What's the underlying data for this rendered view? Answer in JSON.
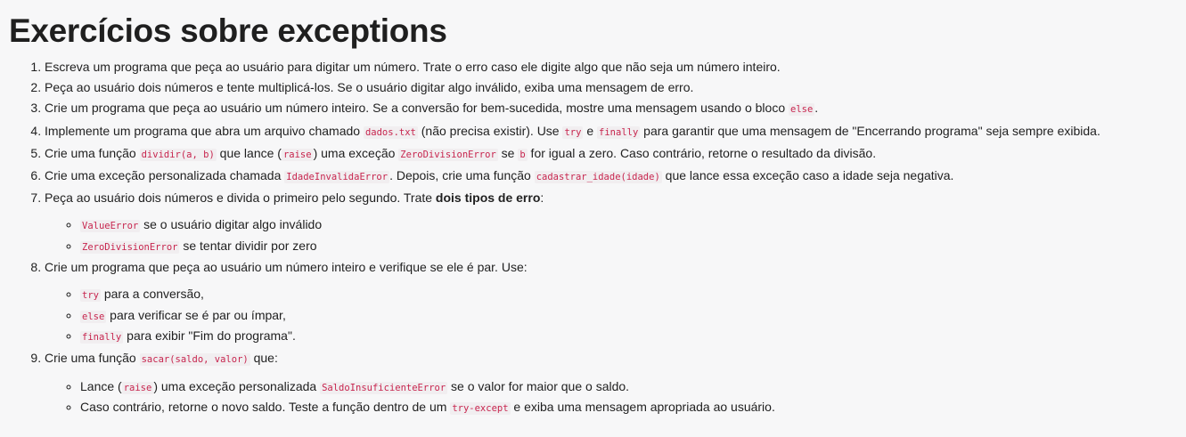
{
  "title": "Exercícios sobre exceptions",
  "items": [
    {
      "num": "1.",
      "parts": [
        "Escreva um programa que peça ao usuário para digitar um número. Trate o erro caso ele digite algo que não seja um número inteiro."
      ]
    },
    {
      "num": "2.",
      "parts": [
        "Peça ao usuário dois números e tente multiplicá-los. Se o usuário digitar algo inválido, exiba uma mensagem de erro."
      ]
    },
    {
      "num": "3.",
      "parts": [
        "Crie um programa que peça ao usuário um número inteiro. Se a conversão for bem-sucedida, mostre uma mensagem usando o bloco ",
        "else",
        "."
      ]
    },
    {
      "num": "4.",
      "parts": [
        "Implemente um programa que abra um arquivo chamado ",
        "dados.txt",
        " (não precisa existir). Use ",
        "try",
        " e ",
        "finally",
        " para garantir que uma mensagem de \"Encerrando programa\" seja sempre exibida."
      ]
    },
    {
      "num": "5.",
      "parts": [
        "Crie uma função ",
        "dividir(a, b)",
        " que lance (",
        "raise",
        ") uma exceção ",
        "ZeroDivisionError",
        " se ",
        "b",
        " for igual a zero. Caso contrário, retorne o resultado da divisão."
      ]
    },
    {
      "num": "6.",
      "parts": [
        "Crie uma exceção personalizada chamada ",
        "IdadeInvalidaError",
        ". Depois, crie uma função ",
        "cadastrar_idade(idade)",
        " que lance essa exceção caso a idade seja negativa."
      ]
    },
    {
      "num": "7.",
      "parts": [
        "Peça ao usuário dois números e divida o primeiro pelo segundo. Trate ",
        "dois tipos de erro",
        ":"
      ],
      "sub": [
        {
          "parts": [
            "ValueError",
            " se o usuário digitar algo inválido"
          ]
        },
        {
          "parts": [
            "ZeroDivisionError",
            " se tentar dividir por zero"
          ]
        }
      ]
    },
    {
      "num": "8.",
      "parts": [
        "Crie um programa que peça ao usuário um número inteiro e verifique se ele é par. Use:"
      ],
      "sub": [
        {
          "parts": [
            "try",
            " para a conversão,"
          ]
        },
        {
          "parts": [
            "else",
            " para verificar se é par ou ímpar,"
          ]
        },
        {
          "parts": [
            "finally",
            " para exibir \"Fim do programa\"."
          ]
        }
      ]
    },
    {
      "num": "9.",
      "parts": [
        "Crie uma função ",
        "sacar(saldo, valor)",
        " que:"
      ],
      "sub": [
        {
          "parts": [
            "Lance (",
            "raise",
            ") uma exceção personalizada ",
            "SaldoInsuficienteError",
            " se o valor for maior que o saldo."
          ]
        },
        {
          "parts": [
            "Caso contrário, retorne o novo saldo. Teste a função dentro de um ",
            "try-except",
            " e exiba uma mensagem apropriada ao usuário."
          ]
        }
      ]
    }
  ]
}
